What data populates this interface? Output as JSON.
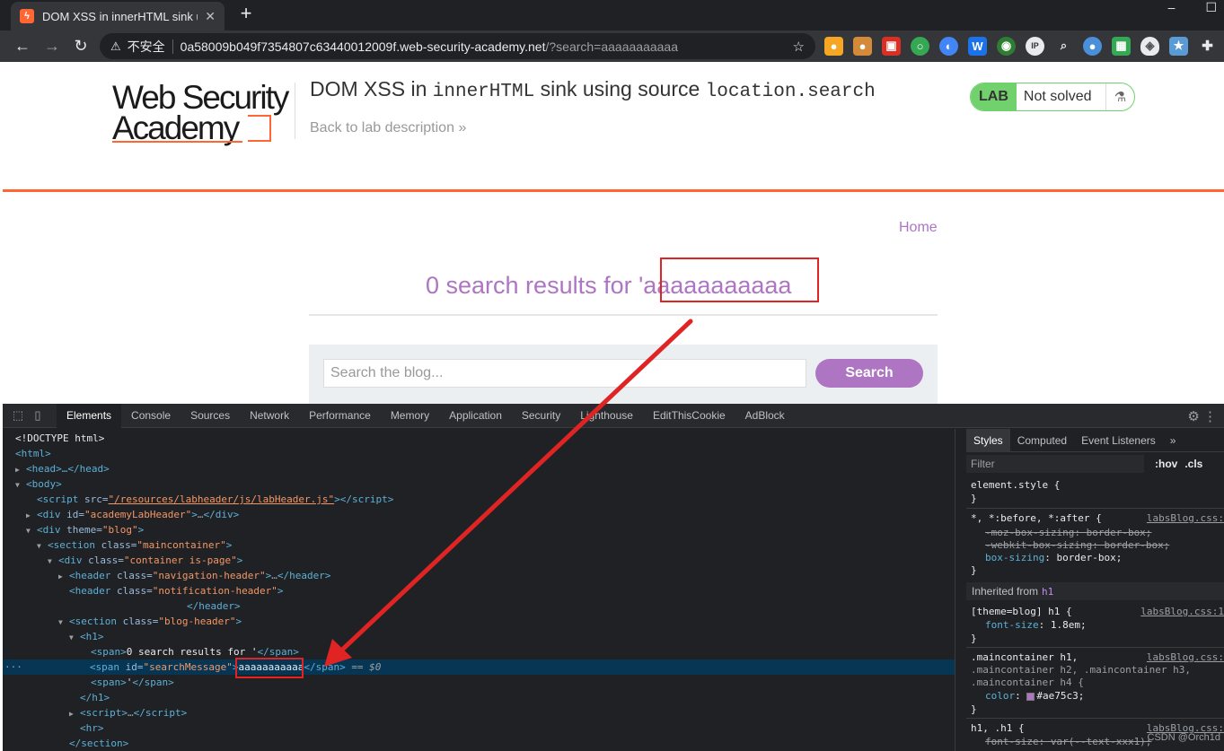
{
  "browser": {
    "tab_title": "DOM XSS in innerHTML sink u",
    "new_tab": "+",
    "insecure_label": "不安全",
    "url_host": "0a58009b049f7354807c63440012009f.web-security-academy.net",
    "url_path": "/?search=aaaaaaaaaaa"
  },
  "lab_header": {
    "logo_line1": "Web Security",
    "logo_line2": "Academy",
    "title_part1": "DOM XSS in ",
    "title_code1": "innerHTML",
    "title_part2": " sink using source ",
    "title_code2": "location.search",
    "back_link": "Back to lab description",
    "back_chevron": "»",
    "badge_lab": "LAB",
    "badge_status": "Not solved"
  },
  "blog": {
    "home_link": "Home",
    "results_prefix": "0 search results for '",
    "results_query": "aaaaaaaaaaa",
    "search_placeholder": "Search the blog...",
    "search_button": "Search"
  },
  "devtools": {
    "tabs": [
      "Elements",
      "Console",
      "Sources",
      "Network",
      "Performance",
      "Memory",
      "Application",
      "Security",
      "Lighthouse",
      "EditThisCookie",
      "AdBlock"
    ],
    "active_tab": "Elements",
    "styles_tabs": [
      "Styles",
      "Computed",
      "Event Listeners"
    ],
    "styles_more": "»",
    "filter_placeholder": "Filter",
    "hov": ":hov",
    "cls": ".cls",
    "dom": {
      "doctype": "<!DOCTYPE html>",
      "html_open": "<html>",
      "head": "<head>…</head>",
      "body_open": "<body>",
      "script_src_attr": "src=",
      "script_src_val": "\"/resources/labheader/js/labHeader.js\"",
      "div_id_val": "\"academyLabHeader\"",
      "theme_val": "\"blog\"",
      "section_class_val": "\"maincontainer\"",
      "container_class_val": "\"container is-page\"",
      "nav_header_val": "\"navigation-header\"",
      "notif_header_val": "\"notification-header\"",
      "blog_header_val": "\"blog-header\"",
      "span1_text": "0 search results for '",
      "span_id_val": "\"searchMessage\"",
      "span2_text": "aaaaaaaaaaa",
      "sel_marker": "== $0",
      "span3_text": "'"
    },
    "styles": {
      "element_style": "element.style {",
      "close": "}",
      "universal_selector": "*, *:before, *:after {",
      "universal_src": "labsBlog.css:",
      "moz_box": "-moz-box-sizing: border-box;",
      "webkit_box_prop": "-webkit-box-sizing",
      "webkit_box_val": ": border-box;",
      "box_sizing_prop": "box-sizing",
      "box_sizing_val": ": border-box;",
      "inherited_from": "Inherited from",
      "inherited_tag": "h1",
      "theme_selector": "[theme=blog] h1 {",
      "theme_src": "labsBlog.css:1",
      "font_size_prop": "font-size",
      "font_size_val": ": 1.8em;",
      "main_selector_1": ".maincontainer h1,",
      "main_selector_2": ".maincontainer h2, .maincontainer h3,",
      "main_selector_3": ".maincontainer h4 {",
      "main_src": "labsBlog.css:",
      "color_prop": "color",
      "color_val": "#ae75c3;",
      "h1_selector": "h1, .h1 {",
      "h1_src": "labsBlog.css:",
      "font_size_var": "font-size: var(--text-xxx1);"
    },
    "watermark": "CSDN @Orch1d"
  },
  "colors": {
    "brand_orange": "#ff6633",
    "blog_purple": "#ae75c3",
    "lab_green": "#70d16d",
    "highlight_red": "#e02424"
  }
}
